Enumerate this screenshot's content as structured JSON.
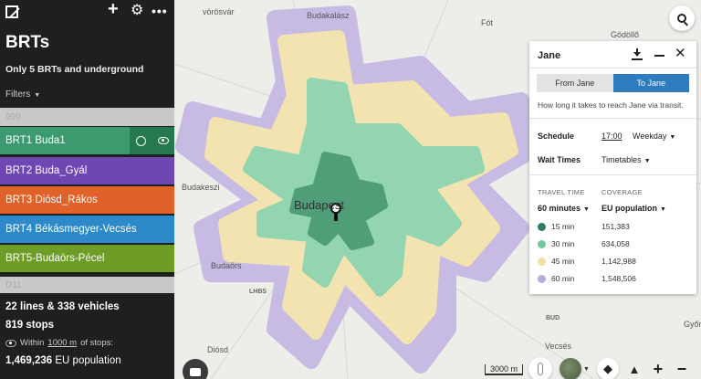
{
  "sidebar": {
    "title": "BRTs",
    "subtitle": "Only 5 BRTs and underground",
    "filters_label": "Filters",
    "icons": {
      "logo": "logo-icon",
      "add": "plus-icon",
      "settings": "gear-icon",
      "more": "more-icon"
    },
    "routes": [
      {
        "name": "999",
        "color": "#c9c9c9"
      },
      {
        "name": "BRT1 Buda1",
        "color": "#3d9a6e"
      },
      {
        "name": "BRT2 Buda_Gyál",
        "color": "#6f47b3"
      },
      {
        "name": "BRT3 Diósd_Rákos",
        "color": "#e0612a"
      },
      {
        "name": "BRT4 Békásmegyer-Vecsés",
        "color": "#2d89c8"
      },
      {
        "name": "BRT5-Budaörs-Pécel",
        "color": "#6e9d27"
      },
      {
        "name": "D11",
        "color": "#c9c9c9"
      }
    ],
    "stats": {
      "lines": "22",
      "lines_label": "lines &",
      "vehicles": "338",
      "vehicles_label": "vehicles",
      "stops": "819",
      "stops_label": "stops",
      "within_prefix": "Within",
      "within_distance": "1000 m",
      "within_suffix": "of stops:",
      "population": "1,469,236",
      "population_label": "EU population"
    }
  },
  "map": {
    "places": {
      "budakalasz": "Budakalász",
      "fot": "Fót",
      "godollo": "Gödöllő",
      "vorosvar": "vörösvár",
      "budakeszi": "Budakeszi",
      "budapest": "Budapest",
      "budaors": "Budaörs",
      "lh85": "LHBS",
      "bud": "BUD",
      "diosd": "Diósd",
      "vecses": "Vecsés",
      "gyor": "Győr"
    },
    "scale_label": "3000 m",
    "zoom_in": "+",
    "zoom_out": "−"
  },
  "panel": {
    "title": "Jane",
    "tabs": {
      "from": "From Jane",
      "to": "To Jane"
    },
    "active_tab": "to",
    "description": "How long it takes to reach Jane via transit.",
    "schedule_label": "Schedule",
    "schedule_time": "17:00",
    "schedule_day": "Weekday",
    "wait_label": "Wait Times",
    "wait_value": "Timetables",
    "travel_time_header": "TRAVEL TIME",
    "coverage_header": "COVERAGE",
    "travel_time_select": "60 minutes",
    "coverage_select": "EU population",
    "legend": [
      {
        "time": "15 min",
        "coverage": "151,383",
        "color": "#2e7d5b"
      },
      {
        "time": "30 min",
        "coverage": "634,058",
        "color": "#6fcb9a"
      },
      {
        "time": "45 min",
        "coverage": "1,142,988",
        "color": "#f3dfa0"
      },
      {
        "time": "60 min",
        "coverage": "1,548,506",
        "color": "#b9a9dc"
      }
    ]
  }
}
